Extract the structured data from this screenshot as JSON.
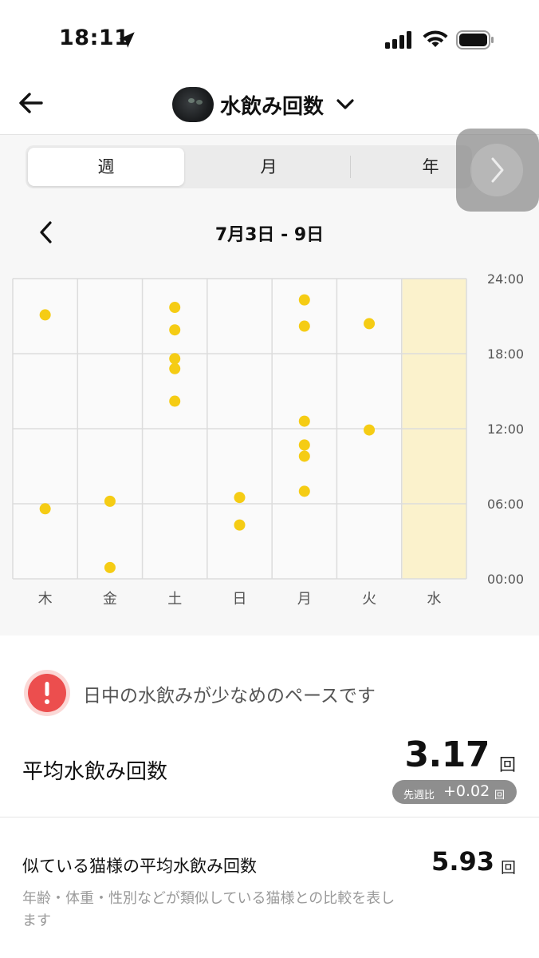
{
  "status_bar": {
    "time": "18:11"
  },
  "header": {
    "title": "水飲み回数"
  },
  "period_tabs": [
    {
      "label": "週",
      "selected": true
    },
    {
      "label": "月",
      "selected": false
    },
    {
      "label": "年",
      "selected": false
    }
  ],
  "week_nav": {
    "range_label": "7月3日 - 9日"
  },
  "chart_data": {
    "type": "scatter",
    "x_categories": [
      "木",
      "金",
      "土",
      "日",
      "月",
      "火",
      "水"
    ],
    "y_ticks": [
      "00:00",
      "06:00",
      "12:00",
      "18:00",
      "24:00"
    ],
    "ylim": [
      0,
      24
    ],
    "highlighted_category": "水",
    "point_color": "#f5cc14",
    "highlight_color": "#fbf2cc",
    "points": [
      {
        "day": "木",
        "hour": 21.1
      },
      {
        "day": "木",
        "hour": 5.6
      },
      {
        "day": "金",
        "hour": 6.2
      },
      {
        "day": "金",
        "hour": 0.9
      },
      {
        "day": "土",
        "hour": 21.7
      },
      {
        "day": "土",
        "hour": 19.9
      },
      {
        "day": "土",
        "hour": 17.6
      },
      {
        "day": "土",
        "hour": 16.8
      },
      {
        "day": "土",
        "hour": 14.2
      },
      {
        "day": "日",
        "hour": 6.5
      },
      {
        "day": "日",
        "hour": 4.3
      },
      {
        "day": "月",
        "hour": 22.3
      },
      {
        "day": "月",
        "hour": 20.2
      },
      {
        "day": "月",
        "hour": 12.6
      },
      {
        "day": "月",
        "hour": 10.7
      },
      {
        "day": "月",
        "hour": 9.8
      },
      {
        "day": "月",
        "hour": 7.0
      },
      {
        "day": "火",
        "hour": 20.4
      },
      {
        "day": "火",
        "hour": 11.9
      }
    ]
  },
  "alert": {
    "text": "日中の水飲みが少なめのペースです",
    "color": "#ec4e4e"
  },
  "average": {
    "label": "平均水飲み回数",
    "value": "3.17",
    "unit": "回",
    "compare_label": "先週比",
    "compare_value": "+0.02",
    "compare_unit": "回"
  },
  "similar": {
    "label": "似ている猫様の平均水飲み回数",
    "value": "5.93",
    "unit": "回",
    "note": "年齢・体重・性別などが類似している猫様との比較を表します"
  }
}
